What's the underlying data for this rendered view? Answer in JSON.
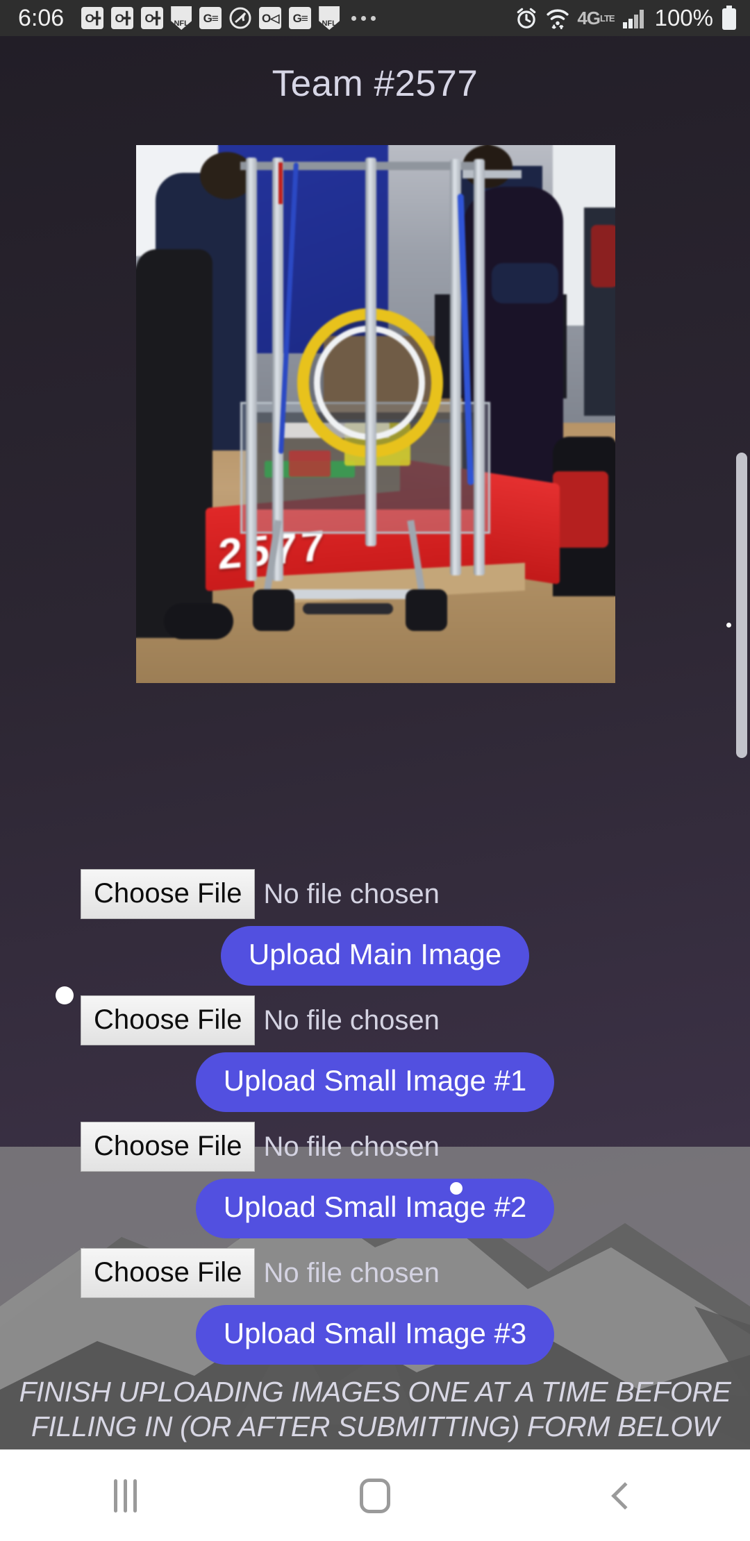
{
  "status_bar": {
    "clock": "6:06",
    "battery_percent": "100%",
    "network": "4G LTE",
    "left_icons": [
      {
        "name": "outlook-icon",
        "glyph": "O"
      },
      {
        "name": "outlook-icon",
        "glyph": "O"
      },
      {
        "name": "outlook-icon",
        "glyph": "O"
      },
      {
        "name": "nfl-icon",
        "glyph": "NFL"
      },
      {
        "name": "google-news-icon",
        "glyph": "G"
      },
      {
        "name": "sports-ball-icon",
        "glyph": "@"
      },
      {
        "name": "outlook-video-icon",
        "glyph": "O"
      },
      {
        "name": "google-news-icon",
        "glyph": "G"
      },
      {
        "name": "nfl-icon",
        "glyph": "NFL"
      }
    ],
    "overflow_label": "more-notifications",
    "right_icons": [
      {
        "name": "alarm-clock-icon"
      },
      {
        "name": "wifi-icon"
      },
      {
        "name": "network-4g-lte-icon"
      },
      {
        "name": "signal-bars-icon"
      },
      {
        "name": "battery-icon"
      }
    ]
  },
  "page": {
    "title": "Team #2577"
  },
  "photo": {
    "alt_name": "robot-team-photo",
    "bumper_number": "2577"
  },
  "form": {
    "rows": [
      {
        "choose_label": "Choose File",
        "file_status": "No file chosen",
        "upload_label": "Upload Main Image"
      },
      {
        "choose_label": "Choose File",
        "file_status": "No file chosen",
        "upload_label": "Upload Small Image #1"
      },
      {
        "choose_label": "Choose File",
        "file_status": "No file chosen",
        "upload_label": "Upload Small Image #2"
      },
      {
        "choose_label": "Choose File",
        "file_status": "No file chosen",
        "upload_label": "Upload Small Image #3"
      }
    ],
    "notice": "FINISH UPLOADING IMAGES ONE AT A TIME BEFORE FILLING IN (OR AFTER SUBMITTING) FORM BELOW"
  },
  "nav_bar": {
    "recents_label": "recents-button",
    "home_label": "home-button",
    "back_label": "back-button"
  },
  "colors": {
    "accent_purple": "#5250e0",
    "background_top": "#221e27",
    "background_bottom": "#473a52",
    "status_bar": "#2e2e2e",
    "bumper_red": "#e02828",
    "overlay_gray": "#8c8c8c"
  }
}
